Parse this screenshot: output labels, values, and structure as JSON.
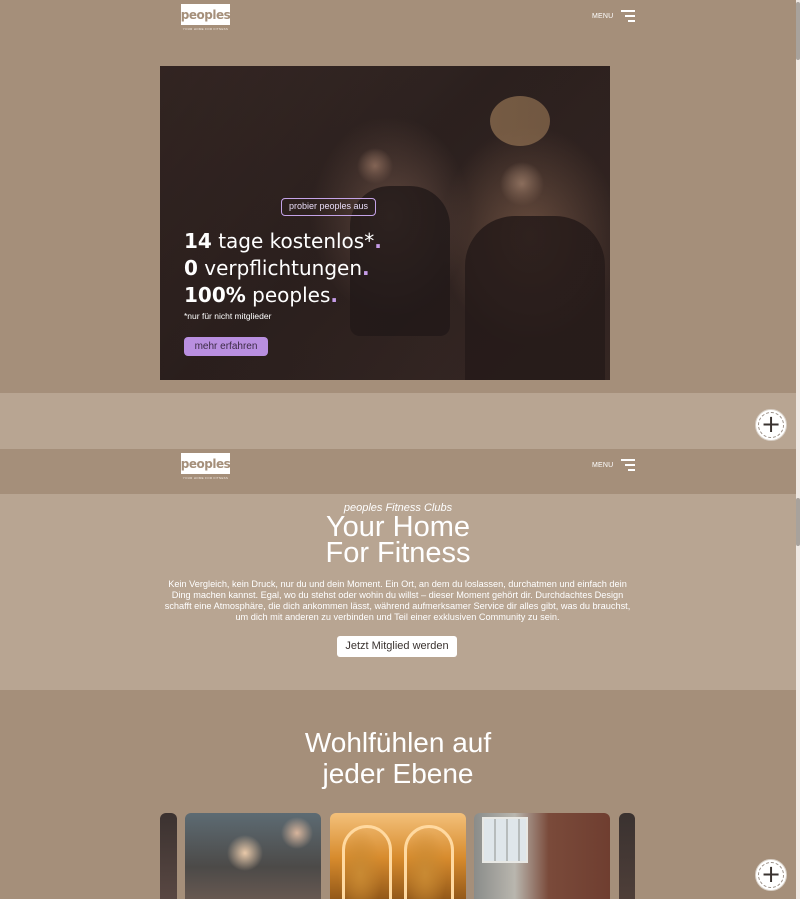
{
  "brand": {
    "logo_text": "peoples",
    "tagline": "YOUR HOME FOR FITNESS"
  },
  "header": {
    "menu_label": "MENU"
  },
  "hero": {
    "badge": "probier peoples aus",
    "lines": [
      {
        "num": "14",
        "text": " tage kostenlos*"
      },
      {
        "num": "0",
        "text": " verpflichtungen"
      },
      {
        "num": "100%",
        "text": " peoples"
      }
    ],
    "footnote": "*nur für nicht mitglieder",
    "cta_label": "mehr erfahren",
    "accent_color": "#b98fe0"
  },
  "intro": {
    "kicker": "peoples Fitness Clubs",
    "title_line1": "Your Home",
    "title_line2": "For Fitness",
    "body": "Kein Vergleich, kein Druck, nur du und dein Moment. Ein Ort, an dem du loslassen, durchatmen und einfach dein Ding machen kannst. Egal, wo du stehst oder wohin du willst – dieser Moment gehört dir. Durchdachtes Design schafft eine Atmosphäre, die dich ankommen lässt, während aufmerksamer Service dir alles gibt, was du brauchst, um dich mit anderen zu verbinden und Teil einer exklusiven Community zu sein.",
    "cta_label": "Jetzt Mitglied werden"
  },
  "wellbeing": {
    "title_line1": "Wohlfühlen auf",
    "title_line2": "jeder Ebene"
  },
  "colors": {
    "page_bg": "#a58f7a",
    "band_bg": "#b8a592",
    "text": "#ffffff"
  }
}
